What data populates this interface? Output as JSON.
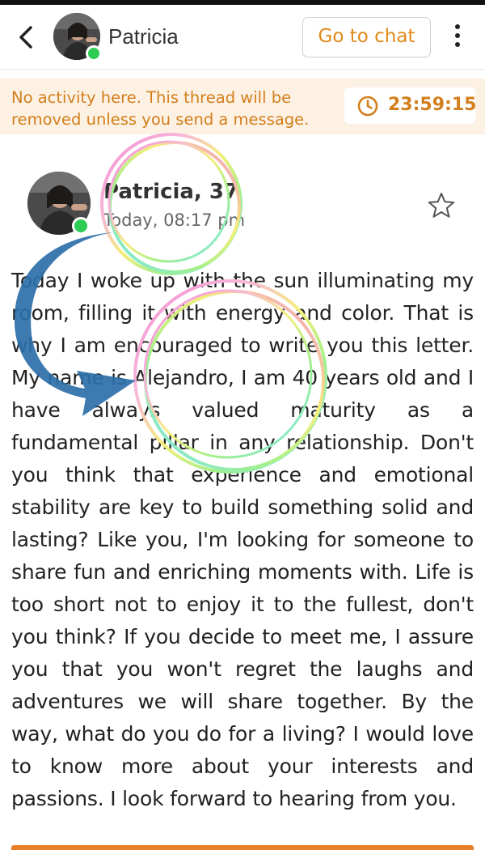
{
  "header": {
    "back_icon": "chevron-left-icon",
    "name": "Patricia",
    "go_to_chat_label": "Go to chat",
    "menu_icon": "more-vertical-icon"
  },
  "notice": {
    "text": "No activity here. This thread will be removed unless you send a message.",
    "timer": "23:59:15",
    "timer_icon": "clock-icon"
  },
  "letter": {
    "author": "Patricia, 37",
    "timestamp": "Today, 08:17 pm",
    "star_icon": "star-outline-icon",
    "body": "Today I woke up with the sun illuminating my room, filling it with energy and color. That is why I am encouraged to write you this letter. My name is Alejandro, I am 40 years old and I have always valued maturity as a fundamental pillar in any relationship. Don't you think that experience and emotional stability are key to build something solid and lasting? Like you, I'm looking for someone to share fun and enriching moments with. Life is too short not to enjoy it to the fullest, don't you think? If you decide to meet me, I assure you that you won't regret the laughs and adventures we will share together. By the way, what do you do for a living? I would love to know more about your interests and passions. I look forward to hearing from you."
  },
  "colors": {
    "accent": "#e0891a",
    "notice_bg": "#fdf1e4",
    "online": "#2ecc55",
    "arrow": "#2b6fa8"
  }
}
